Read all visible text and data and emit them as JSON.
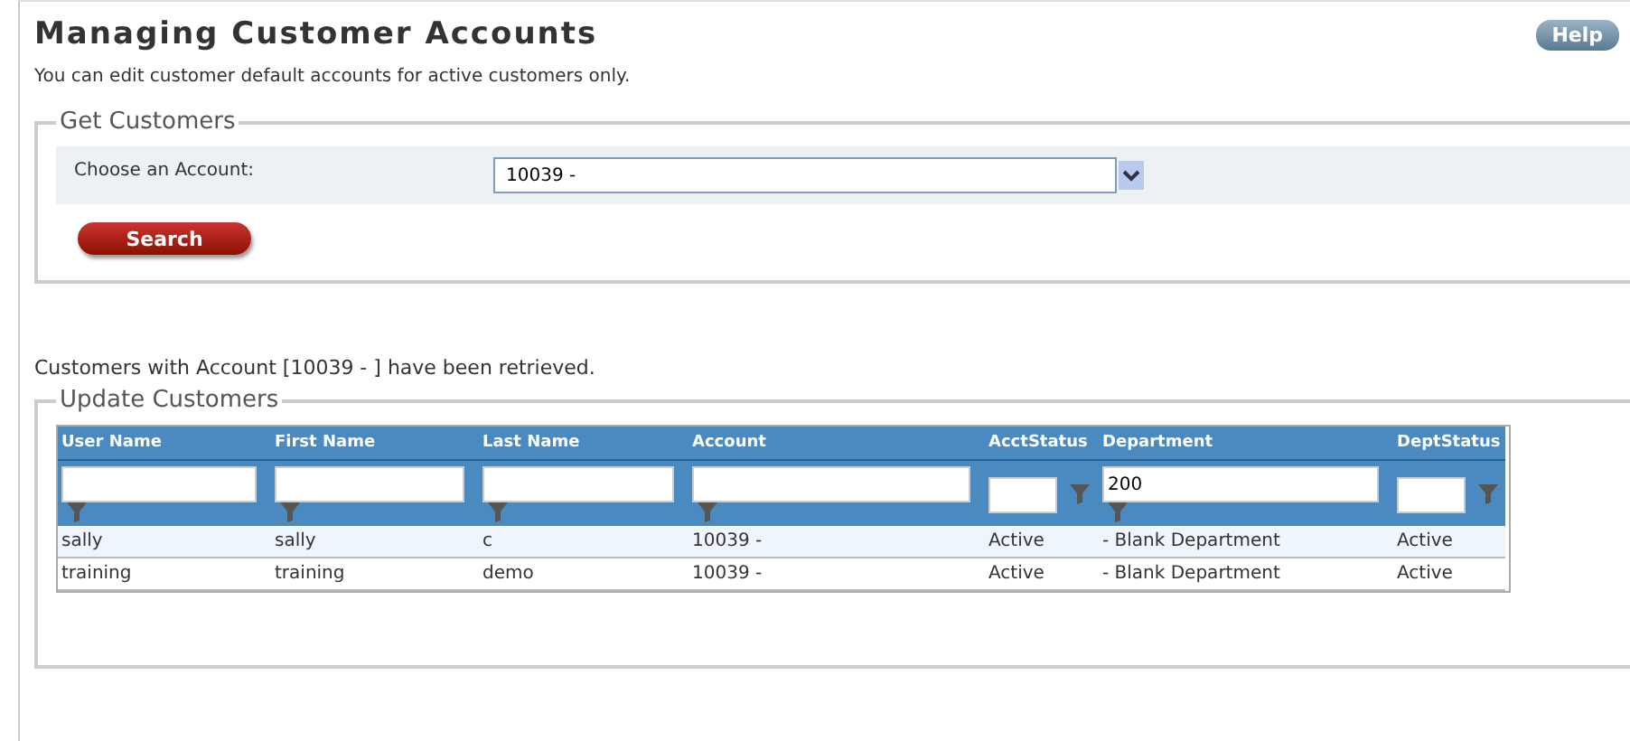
{
  "title": "Managing Customer Accounts",
  "help_button": "Help",
  "intro": "You can edit customer default accounts for active customers only.",
  "get_customers": {
    "legend": "Get Customers",
    "label": "Choose an Account:",
    "account_value": "10039 -",
    "search_button": "Search"
  },
  "message": "Customers with Account [10039 - ] have been retrieved.",
  "update_customers": {
    "legend": "Update Customers",
    "table": {
      "columns": [
        {
          "label": "User Name",
          "kind": "wide"
        },
        {
          "label": "First Name",
          "kind": "wide"
        },
        {
          "label": "Last Name",
          "kind": "wide"
        },
        {
          "label": "Account",
          "kind": "wide"
        },
        {
          "label": "AcctStatus",
          "kind": "narrow"
        },
        {
          "label": "Department",
          "kind": "wide",
          "filter_value": "200"
        },
        {
          "label": "DeptStatus",
          "kind": "narrow"
        }
      ],
      "rows": [
        [
          "sally",
          "sally",
          "c",
          "10039 -",
          "Active",
          "- Blank Department",
          "Active"
        ],
        [
          "training",
          "training",
          "demo",
          "10039 -",
          "Active",
          "- Blank Department",
          "Active"
        ]
      ]
    }
  }
}
